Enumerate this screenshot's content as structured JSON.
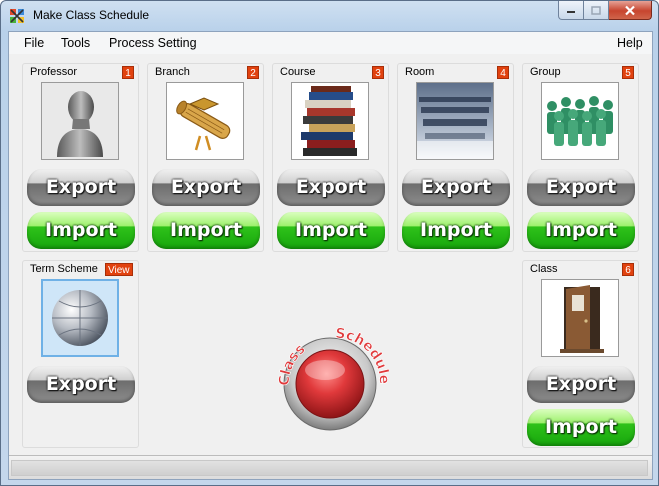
{
  "window": {
    "title": "Make Class Schedule"
  },
  "menu": {
    "file": "File",
    "tools": "Tools",
    "process_setting": "Process Setting",
    "help": "Help"
  },
  "panels": [
    {
      "label": "Professor",
      "badge": "1",
      "export": "Export",
      "import": "Import"
    },
    {
      "label": "Branch",
      "badge": "2",
      "export": "Export",
      "import": "Import"
    },
    {
      "label": "Course",
      "badge": "3",
      "export": "Export",
      "import": "Import"
    },
    {
      "label": "Room",
      "badge": "4",
      "export": "Export",
      "import": "Import"
    },
    {
      "label": "Group",
      "badge": "5",
      "export": "Export",
      "import": "Import"
    }
  ],
  "term_scheme": {
    "label": "Term Scheme",
    "badge": "View",
    "export": "Export"
  },
  "class_panel": {
    "label": "Class",
    "badge": "6",
    "export": "Export",
    "import": "Import"
  },
  "schedule_button": {
    "word1": "Class",
    "word2": "Schedule",
    "color": "#e0393b"
  },
  "colors": {
    "badge": "#e1420f",
    "export": "#7a7a7a",
    "import": "#22b515"
  }
}
